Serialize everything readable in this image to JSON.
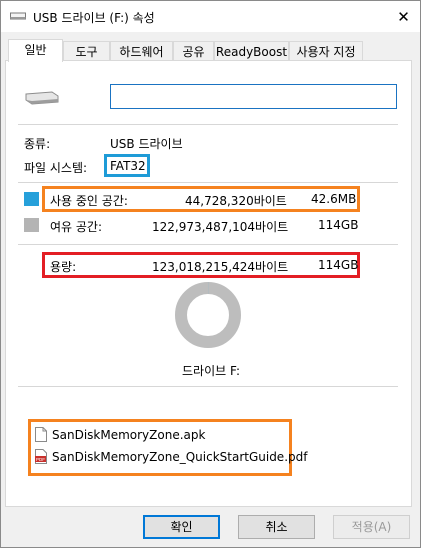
{
  "window": {
    "title": "USB 드라이브 (F:) 속성",
    "close_glyph": "✕"
  },
  "tabs": [
    {
      "label": "일반",
      "active": true
    },
    {
      "label": "도구"
    },
    {
      "label": "하드웨어"
    },
    {
      "label": "공유"
    },
    {
      "label": "ReadyBoost"
    },
    {
      "label": "사용자 지정"
    }
  ],
  "general": {
    "name_value": "",
    "type_label": "종류:",
    "type_value": "USB 드라이브",
    "fs_label": "파일 시스템:",
    "fs_value": "FAT32",
    "used": {
      "label": "사용 중인 공간:",
      "bytes": "44,728,320바이트",
      "size": "42.6MB",
      "color": "#26a0da"
    },
    "free": {
      "label": "여유 공간:",
      "bytes": "122,973,487,104바이트",
      "size": "114GB",
      "color": "#b4b4b4"
    },
    "capacity": {
      "label": "용량:",
      "bytes": "123,018,215,424바이트",
      "size": "114GB"
    },
    "used_fraction": 0.000364,
    "drive_label": "드라이브 F:"
  },
  "files": [
    {
      "name": "SanDiskMemoryZone.apk",
      "icon": "document-icon"
    },
    {
      "name": "SanDiskMemoryZone_QuickStartGuide.pdf",
      "icon": "pdf-icon",
      "badge": "PDF"
    }
  ],
  "buttons": {
    "ok": "확인",
    "cancel": "취소",
    "apply": "적용(A)"
  },
  "highlight_colors": {
    "blue": "#1e9bd7",
    "orange": "#f5821f",
    "red": "#e31e24"
  }
}
